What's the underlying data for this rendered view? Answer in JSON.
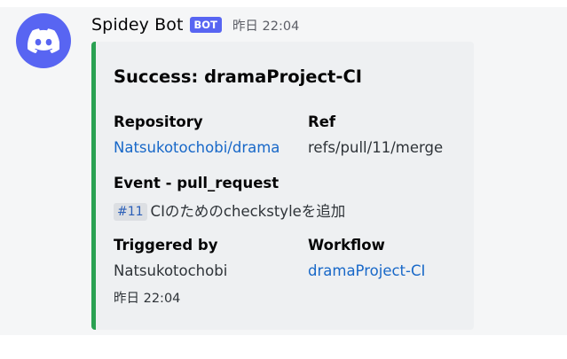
{
  "message": {
    "author": "Spidey Bot",
    "bot_tag": "BOT",
    "timestamp": "昨日 22:04",
    "avatar_icon": "discord-logo-icon",
    "avatar_color": "#5865f2"
  },
  "embed": {
    "accent_color": "#2aa152",
    "title": "Success: dramaProject-CI",
    "fields": {
      "repository_name": "Repository",
      "repository_value": "Natsukotochobi/drama",
      "ref_name": "Ref",
      "ref_value": "refs/pull/11/merge",
      "event_name": "Event - pull_request",
      "event_pr": "#11",
      "event_text": "CIのためのcheckstyleを追加",
      "triggered_name": "Triggered by",
      "triggered_value": "Natsukotochobi",
      "workflow_name": "Workflow",
      "workflow_value": "dramaProject-CI"
    },
    "footer": "昨日 22:04"
  }
}
